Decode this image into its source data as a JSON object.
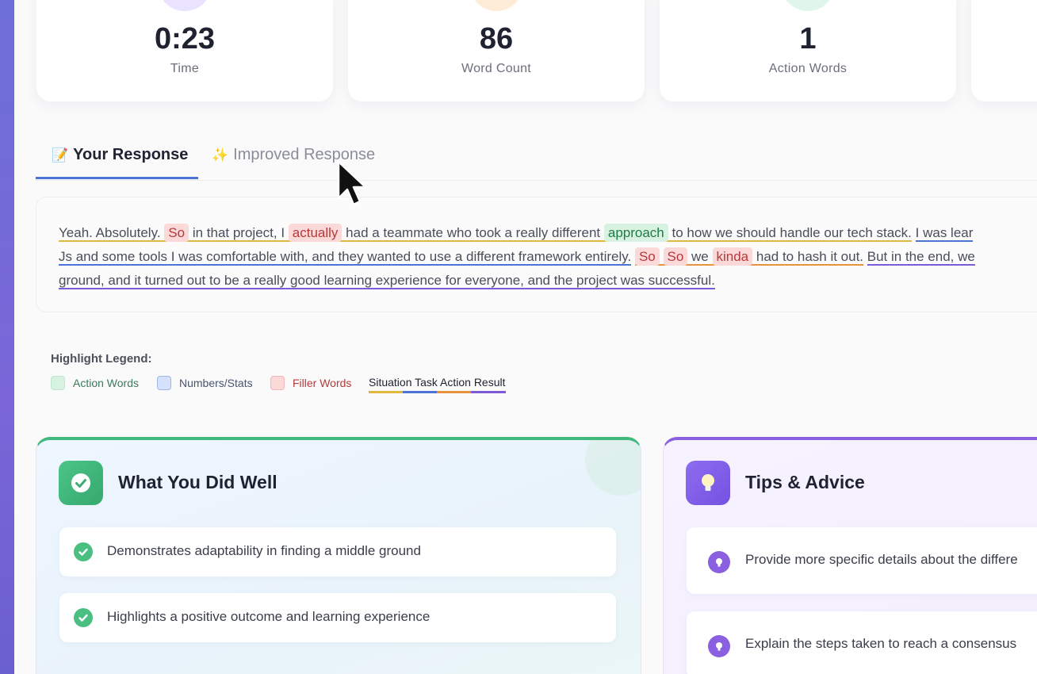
{
  "stats": [
    {
      "value": "0:23",
      "label": "Time"
    },
    {
      "value": "86",
      "label": "Word Count"
    },
    {
      "value": "1",
      "label": "Action Words"
    }
  ],
  "tabs": {
    "your_response": "Your Response",
    "improved_response": "Improved Response",
    "your_icon": "📝",
    "improved_icon": "✨"
  },
  "response": {
    "line1": {
      "a": "Yeah. Absolutely.",
      "so1": "So",
      "b": "in that project, I",
      "actually": "actually",
      "c": "had a teammate who took a really different",
      "approach": "approach",
      "d": "to how we should handle our tech stack.",
      "e": "I was lear"
    },
    "line2": {
      "a": "Js and some tools I was comfortable with, and they wanted to use a different framework entirely.",
      "so2": "So",
      "so3": "So",
      "we": "we",
      "kinda": "kinda",
      "b": "had to hash it out.",
      "c": "But in the end, we"
    },
    "line3": "ground, and it turned out to be a really good learning experience for everyone, and the project was successful."
  },
  "legend": {
    "title": "Highlight Legend:",
    "action_words": "Action Words",
    "numbers_stats": "Numbers/Stats",
    "filler_words": "Filler Words",
    "star": "Situation Task Action Result"
  },
  "well": {
    "title": "What You Did Well",
    "items": [
      "Demonstrates adaptability in finding a middle ground",
      "Highlights a positive outcome and learning experience"
    ]
  },
  "tips": {
    "title": "Tips & Advice",
    "items": [
      "Provide more specific details about the differe",
      "Explain the steps taken to reach a consensus"
    ]
  },
  "colors": {
    "situation": "#e3b73e",
    "task": "#4b74d6",
    "action": "#e9923e",
    "result": "#7d5bd6",
    "action_word_bg": "#d8f2e2",
    "number_bg": "#d6e2fb",
    "filler_bg": "#fbd9d9"
  }
}
